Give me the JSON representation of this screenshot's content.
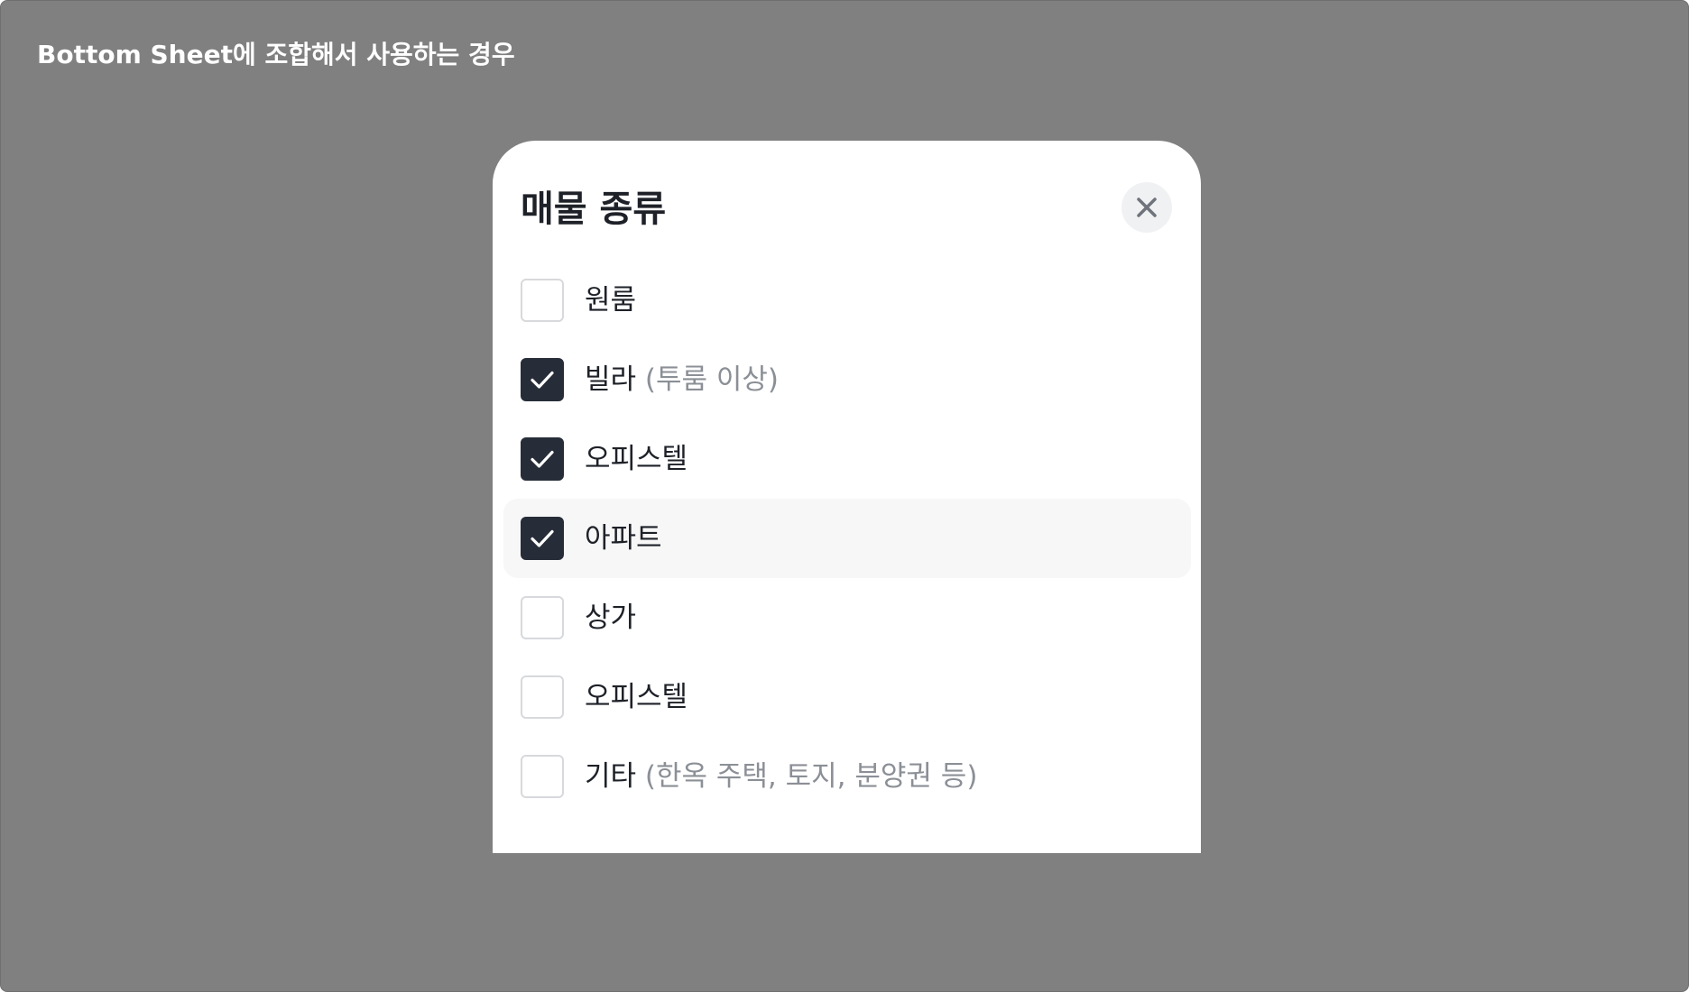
{
  "frame": {
    "title": "Bottom Sheet에 조합해서 사용하는 경우"
  },
  "sheet": {
    "title": "매물 종류",
    "close_icon": "close-icon",
    "options": [
      {
        "label": "원룸",
        "sub": "",
        "checked": false,
        "highlighted": false
      },
      {
        "label": "빌라",
        "sub": "(투룸 이상)",
        "checked": true,
        "highlighted": false
      },
      {
        "label": "오피스텔",
        "sub": "",
        "checked": true,
        "highlighted": false
      },
      {
        "label": "아파트",
        "sub": "",
        "checked": true,
        "highlighted": true
      },
      {
        "label": "상가",
        "sub": "",
        "checked": false,
        "highlighted": false
      },
      {
        "label": "오피스텔",
        "sub": "",
        "checked": false,
        "highlighted": false
      },
      {
        "label": "기타",
        "sub": "(한옥 주택, 토지, 분양권 등)",
        "checked": false,
        "highlighted": false
      }
    ]
  },
  "colors": {
    "backdrop": "#808080",
    "checked": "#272d38",
    "text": "#1e2128",
    "subtext": "#8b8f96",
    "highlight": "#f7f7f7"
  }
}
